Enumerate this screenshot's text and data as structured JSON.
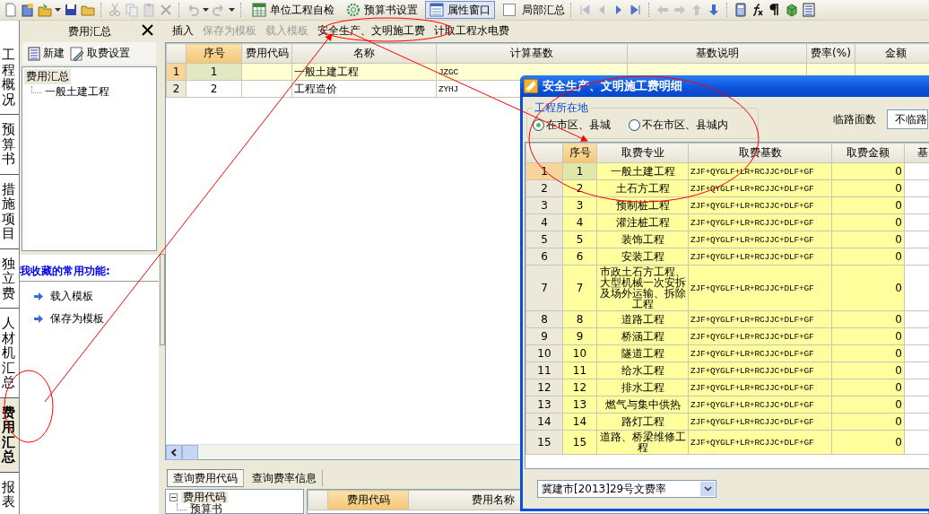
{
  "toolbar": {
    "buttons": [
      {
        "label": "单位工程自检",
        "kind": "check",
        "pressed": false
      },
      {
        "label": "预算书设置",
        "kind": "gear",
        "pressed": false
      },
      {
        "label": "属性窗口",
        "kind": "window",
        "pressed": true
      }
    ],
    "checkbox": {
      "label": "局部汇总",
      "checked": false
    }
  },
  "side_tabs": [
    {
      "label": "工程概况",
      "selected": false
    },
    {
      "label": "预算书",
      "selected": false
    },
    {
      "label": "措施项目",
      "selected": false
    },
    {
      "label": "独立费",
      "selected": false
    },
    {
      "label": "人材机汇总",
      "selected": false
    },
    {
      "label": "费用汇总",
      "selected": true
    },
    {
      "label": "报表",
      "selected": false
    }
  ],
  "left_panel": {
    "title": "费用汇总",
    "actions": [
      {
        "label": "新建",
        "kind": "list"
      },
      {
        "label": "取费设置",
        "kind": "settings"
      }
    ],
    "tree": [
      {
        "label": "费用汇总",
        "selected": true,
        "children": [
          {
            "label": "一般土建工程",
            "selected": false
          }
        ]
      }
    ],
    "favorites": {
      "title": "我收藏的常用功能:",
      "links": [
        "载入模板",
        "保存为模板"
      ]
    }
  },
  "main_toolbar": [
    {
      "label": "插入",
      "disabled": false
    },
    {
      "label": "保存为模板",
      "disabled": true
    },
    {
      "label": "载入模板",
      "disabled": true
    },
    {
      "label": "安全生产、文明施工费",
      "disabled": false
    },
    {
      "label": "计取工程水电费",
      "disabled": false
    }
  ],
  "grid": {
    "columns": [
      "序号",
      "费用代码",
      "名称",
      "计算基数",
      "基数说明",
      "费率(%)",
      "金额"
    ],
    "rows": [
      {
        "row": "1",
        "selected": true,
        "cells": [
          "1",
          "",
          "一般土建工程",
          "JZGC"
        ]
      },
      {
        "row": "2",
        "selected": false,
        "cells": [
          "2",
          "",
          "工程造价",
          "ZYHJ"
        ]
      }
    ]
  },
  "bottom_tabs": [
    {
      "label": "查询费用代码",
      "selected": true
    },
    {
      "label": "查询费率信息",
      "selected": false
    }
  ],
  "code_tree": [
    {
      "label": "费用代码",
      "expanded": true,
      "children": [
        {
          "label": "预算书"
        }
      ]
    }
  ],
  "code_grid": {
    "columns": [
      "费用代码",
      "费用名称"
    ]
  },
  "dialog": {
    "title": "安全生产、文明施工费明细",
    "location": {
      "label": "工程所在地",
      "options": [
        {
          "label": "在市区、县城",
          "selected": true
        },
        {
          "label": "不在市区、县城内",
          "selected": false
        }
      ]
    },
    "frontage": {
      "label": "临路面数",
      "value": "不临路"
    },
    "grid": {
      "columns": [
        "序号",
        "取费专业",
        "取费基数",
        "取费金额",
        "基"
      ],
      "rows": [
        {
          "row": "1",
          "selected": true,
          "cells": [
            "1",
            "一般土建工程",
            "ZJF+QYGLF+LR+RCJJC+DLF+GF",
            "0"
          ]
        },
        {
          "row": "2",
          "selected": false,
          "cells": [
            "2",
            "土石方工程",
            "ZJF+QYGLF+LR+RCJJC+DLF+GF",
            "0"
          ]
        },
        {
          "row": "3",
          "selected": false,
          "cells": [
            "3",
            "预制桩工程",
            "ZJF+QYGLF+LR+RCJJC+DLF+GF",
            "0"
          ]
        },
        {
          "row": "4",
          "selected": false,
          "cells": [
            "4",
            "灌注桩工程",
            "ZJF+QYGLF+LR+RCJJC+DLF+GF",
            "0"
          ]
        },
        {
          "row": "5",
          "selected": false,
          "cells": [
            "5",
            "装饰工程",
            "ZJF+QYGLF+LR+RCJJC+DLF+GF",
            "0"
          ]
        },
        {
          "row": "6",
          "selected": false,
          "cells": [
            "6",
            "安装工程",
            "ZJF+QYGLF+LR+RCJJC+DLF+GF",
            "0"
          ]
        },
        {
          "row": "7",
          "selected": false,
          "cells": [
            "7",
            "市政土石方工程、大型机械一次安拆及场外运输、拆除工程",
            "ZJF+QYGLF+LR+RCJJC+DLF+GF",
            "0"
          ]
        },
        {
          "row": "8",
          "selected": false,
          "cells": [
            "8",
            "道路工程",
            "ZJF+QYGLF+LR+RCJJC+DLF+GF",
            "0"
          ]
        },
        {
          "row": "9",
          "selected": false,
          "cells": [
            "9",
            "桥涵工程",
            "ZJF+QYGLF+LR+RCJJC+DLF+GF",
            "0"
          ]
        },
        {
          "row": "10",
          "selected": false,
          "cells": [
            "10",
            "隧道工程",
            "ZJF+QYGLF+LR+RCJJC+DLF+GF",
            "0"
          ]
        },
        {
          "row": "11",
          "selected": false,
          "cells": [
            "11",
            "给水工程",
            "ZJF+QYGLF+LR+RCJJC+DLF+GF",
            "0"
          ]
        },
        {
          "row": "12",
          "selected": false,
          "cells": [
            "12",
            "排水工程",
            "ZJF+QYGLF+LR+RCJJC+DLF+GF",
            "0"
          ]
        },
        {
          "row": "13",
          "selected": false,
          "cells": [
            "13",
            "燃气与集中供热",
            "ZJF+QYGLF+LR+RCJJC+DLF+GF",
            "0"
          ]
        },
        {
          "row": "14",
          "selected": false,
          "cells": [
            "14",
            "路灯工程",
            "ZJF+QYGLF+LR+RCJJC+DLF+GF",
            "0"
          ]
        },
        {
          "row": "15",
          "selected": false,
          "cells": [
            "15",
            "道路、桥梁维修工程",
            "ZJF+QYGLF+LR+RCJJC+DLF+GF",
            "0"
          ]
        }
      ]
    },
    "rate_select": {
      "value": "冀建市[2013]29号文费率"
    }
  }
}
